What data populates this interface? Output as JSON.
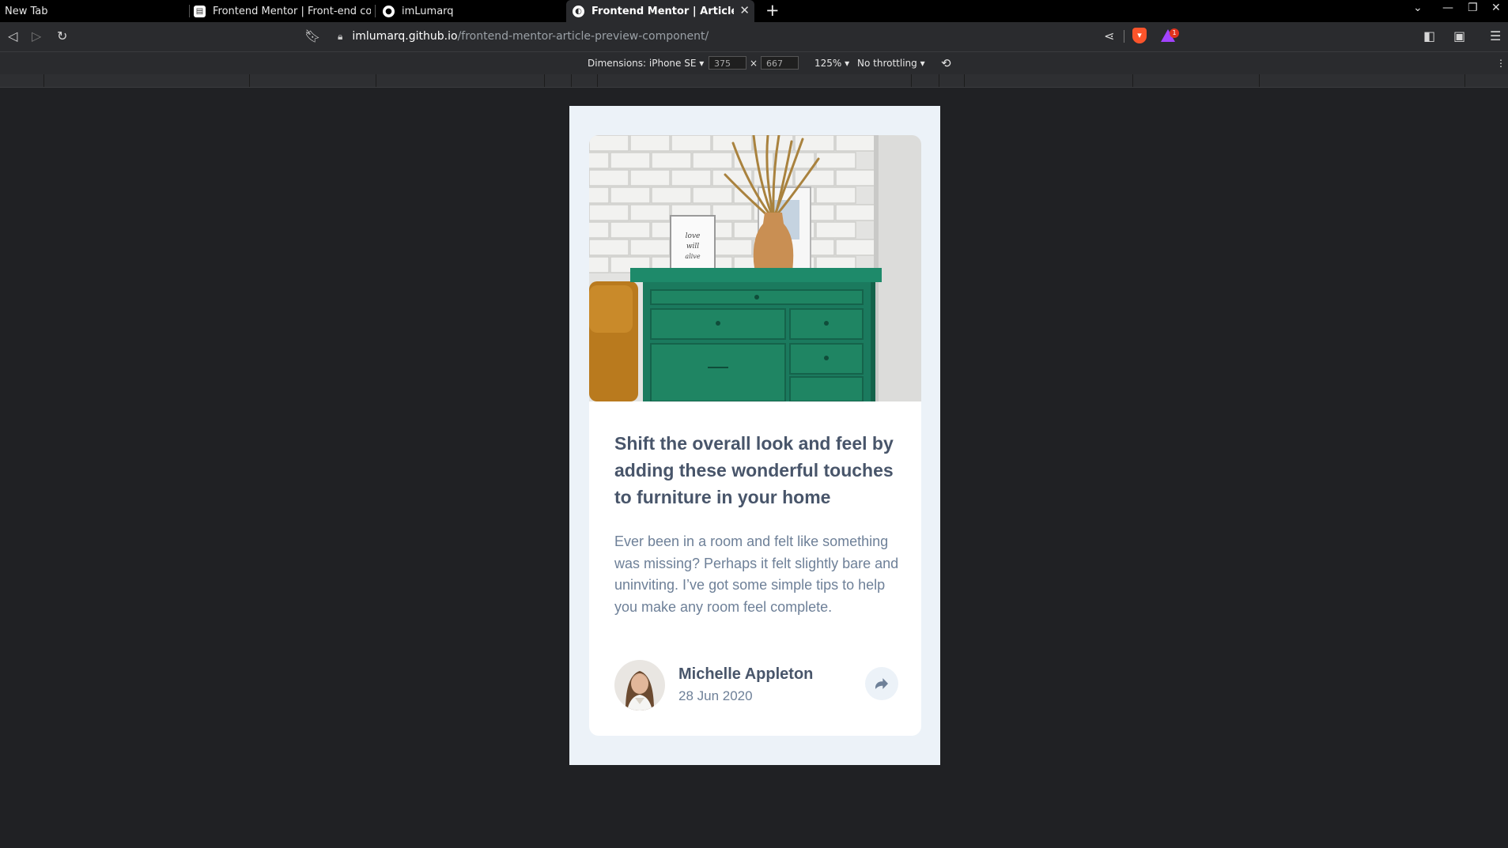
{
  "browser": {
    "tabs": [
      {
        "label": "New Tab",
        "active": false
      },
      {
        "label": "Frontend Mentor | Front-end codi",
        "active": false
      },
      {
        "label": "imLumarq",
        "active": false
      },
      {
        "label": "Frontend Mentor | Article Previ",
        "active": true
      }
    ],
    "close_glyph": "✕",
    "new_tab_glyph": "+",
    "url": {
      "host": "imlumarq.github.io",
      "path": "/frontend-mentor-article-preview-component/"
    }
  },
  "devtools": {
    "dimensions_label": "Dimensions: iPhone SE",
    "width": "375",
    "times": "×",
    "height": "667",
    "zoom": "125%",
    "throttling": "No throttling",
    "badge_count": "1"
  },
  "article": {
    "title": "Shift the overall look and feel by adding these wonderful touches to furniture in your home",
    "description": "Ever been in a room and felt like something was missing? Perhaps it felt slightly bare and uninviting. I’ve got some simple tips to help you make any room feel complete.",
    "author": "Michelle Appleton",
    "date": "28 Jun 2020",
    "hero_text": "love will keep us alive"
  },
  "colors": {
    "page_bg": "#202124",
    "viewport_bg": "#ecf2f8",
    "heading": "#48556a",
    "body_text": "#6e8098",
    "share_bg": "#ecf2f8"
  }
}
